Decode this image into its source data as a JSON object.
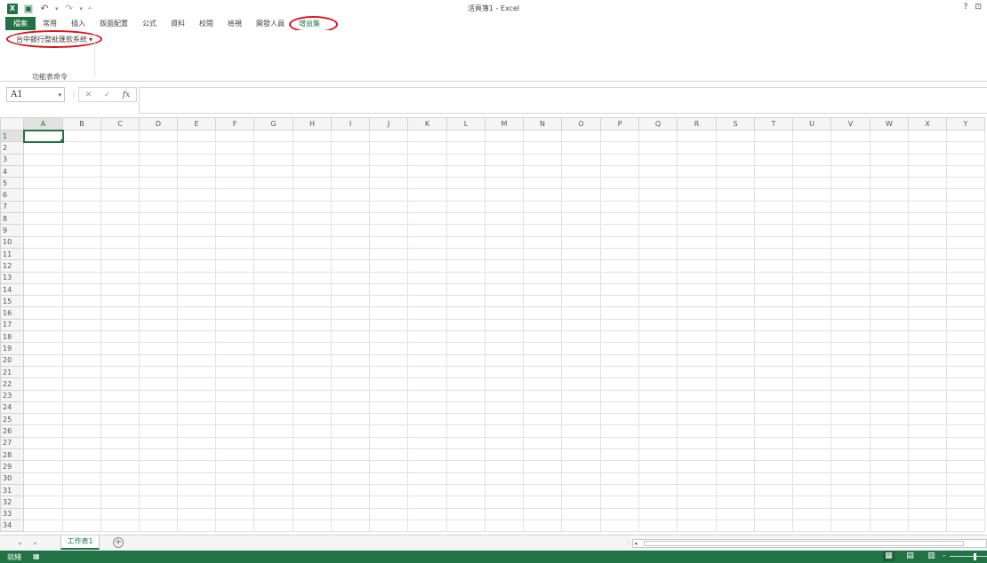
{
  "window": {
    "title": "活頁簿1 - Excel",
    "logo": "X",
    "help_label": "?",
    "ribbon_display_icon": "ribbon-display-icon"
  },
  "qat": {
    "save_icon": "save-icon",
    "undo_icon": "undo-icon",
    "redo_icon": "redo-icon",
    "customize_icon": "customize-qat-icon"
  },
  "tabs": [
    {
      "label": "檔案",
      "kind": "file"
    },
    {
      "label": "常用"
    },
    {
      "label": "插入"
    },
    {
      "label": "版面配置"
    },
    {
      "label": "公式"
    },
    {
      "label": "資料"
    },
    {
      "label": "校閱"
    },
    {
      "label": "檢視"
    },
    {
      "label": "開發人員"
    },
    {
      "label": "增益集",
      "active": true
    }
  ],
  "ribbon": {
    "addin_button": "台中銀行整批匯款系統",
    "addin_dropdown": "▾",
    "group_label": "功能表命令"
  },
  "formula_bar": {
    "name_box": "A1",
    "name_box_arrow": "▾",
    "cancel": "✕",
    "enter": "✓",
    "fx": "fx",
    "formula_value": ""
  },
  "grid": {
    "columns": [
      "A",
      "B",
      "C",
      "D",
      "E",
      "F",
      "G",
      "H",
      "I",
      "J",
      "K",
      "L",
      "M",
      "N",
      "O",
      "P",
      "Q",
      "R",
      "S",
      "T",
      "U",
      "V",
      "W",
      "X",
      "Y"
    ],
    "rows": [
      "1",
      "2",
      "3",
      "4",
      "5",
      "6",
      "7",
      "8",
      "9",
      "10",
      "11",
      "12",
      "13",
      "14",
      "15",
      "16",
      "17",
      "18",
      "19",
      "20",
      "21",
      "22",
      "23",
      "24",
      "25",
      "26",
      "27",
      "28",
      "29",
      "30",
      "31",
      "32",
      "33",
      "34"
    ],
    "active_cell": "A1"
  },
  "sheets": [
    {
      "label": "工作表1",
      "active": true
    }
  ],
  "sheetbar": {
    "prev": "◂",
    "next": "▸",
    "add_sheet": "+",
    "scroll_left": "◂"
  },
  "status": {
    "ready": "就緒",
    "macro_icon": "macro-record-icon",
    "zoom_minus": "-"
  },
  "colors": {
    "accent": "#217346",
    "highlight_circle": "#d9151e"
  }
}
